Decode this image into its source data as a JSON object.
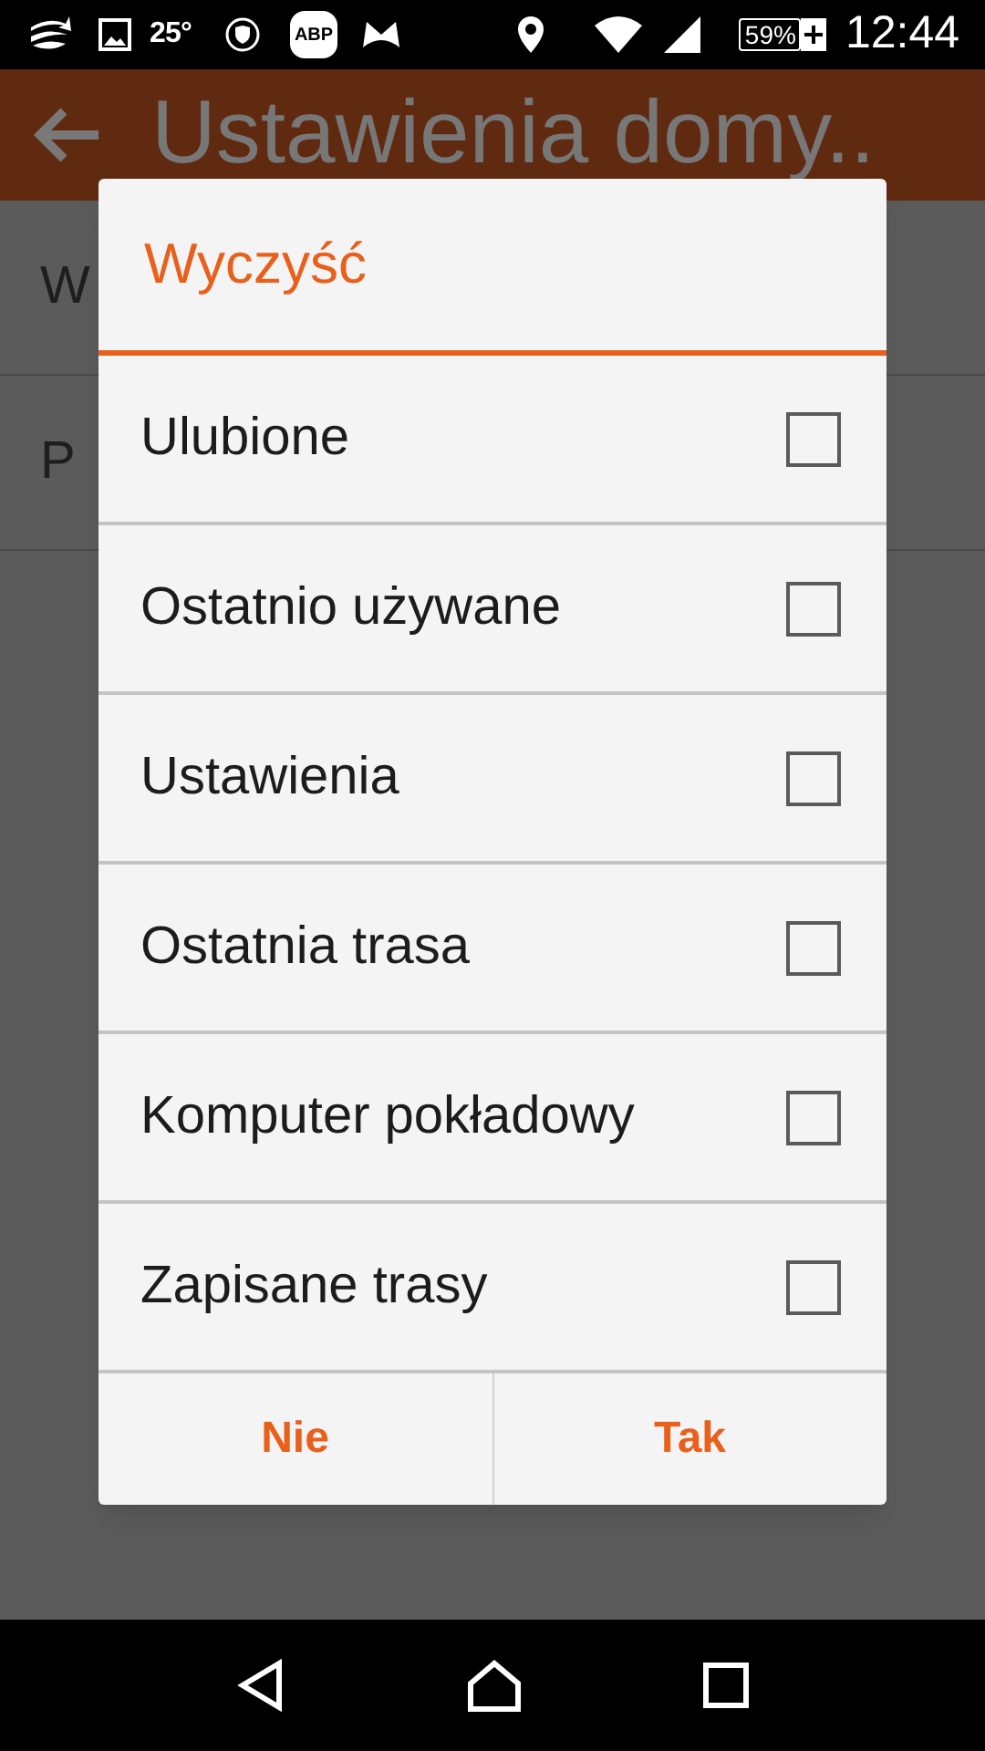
{
  "status_bar": {
    "temperature": "25°",
    "adblock_label": "ABP",
    "battery": "59%",
    "time": "12:44"
  },
  "app_bar": {
    "title": "Ustawienia domy.."
  },
  "background_items": [
    {
      "label": "W"
    },
    {
      "label": "P"
    }
  ],
  "dialog": {
    "title": "Wyczyść",
    "options": [
      {
        "label": "Ulubione",
        "checked": false
      },
      {
        "label": "Ostatnio używane",
        "checked": false
      },
      {
        "label": "Ustawienia",
        "checked": false
      },
      {
        "label": "Ostatnia trasa",
        "checked": false
      },
      {
        "label": "Komputer pokładowy",
        "checked": false
      },
      {
        "label": "Zapisane trasy",
        "checked": false
      }
    ],
    "buttons": [
      {
        "label": "Nie"
      },
      {
        "label": "Tak"
      }
    ]
  }
}
